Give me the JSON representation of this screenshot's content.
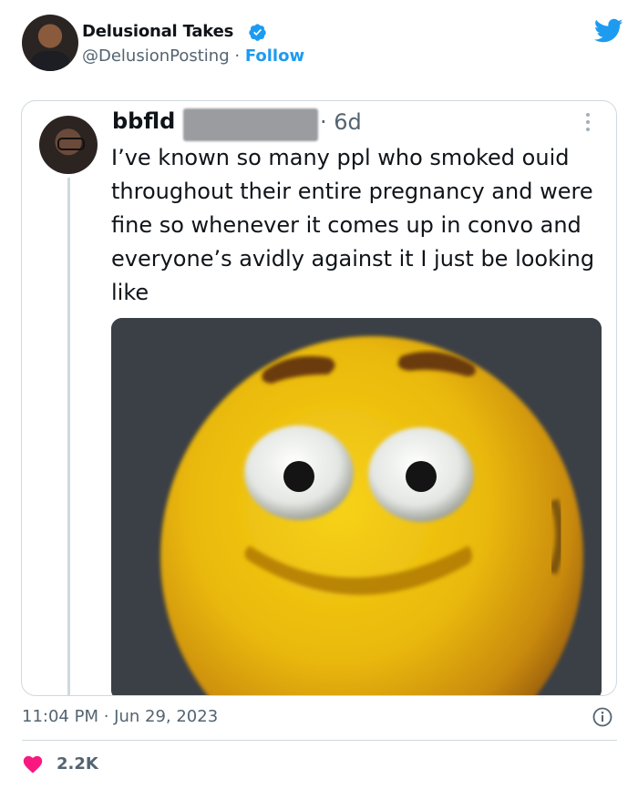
{
  "tweet": {
    "author_name": "Delusional Takes",
    "author_handle": "@DelusionPosting",
    "separator": " · ",
    "follow_label": "Follow",
    "timestamp": "11:04 PM · Jun 29, 2023",
    "like_count": "2.2K"
  },
  "quoted": {
    "author_name": "bbfld",
    "time": "· 6d",
    "text": "I’ve known so many ppl who smoked ouid throughout their entire pregnancy and were fine so whenever it comes up in convo and everyone’s avidly against it I just be looking like",
    "media_alt": "yellow emoji face with wide eyes"
  },
  "colors": {
    "brand_blue": "#1d9bf0",
    "heart_pink": "#f91880",
    "secondary_text": "#536471",
    "border": "#cfd9de"
  },
  "icons": [
    "verified-badge-icon",
    "twitter-bird-icon",
    "more-options-icon",
    "info-icon",
    "heart-icon"
  ]
}
